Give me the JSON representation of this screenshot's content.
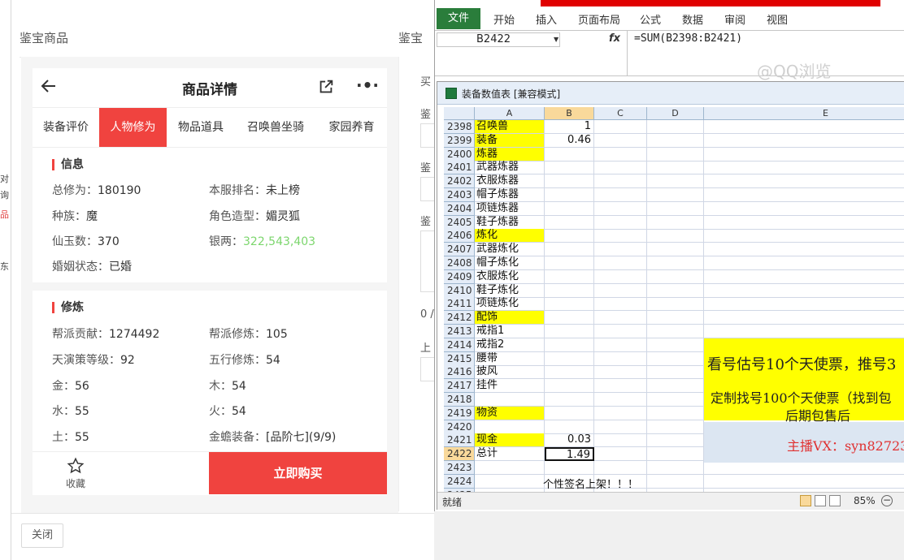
{
  "left_strip": {
    "chars": [
      "对",
      "询",
      "品",
      "东"
    ]
  },
  "dialog": {
    "title": "鉴宝商品",
    "title_right": "鉴宝",
    "close_label": "关闭"
  },
  "phone": {
    "title": "商品详情",
    "tabs": [
      {
        "label": "装备评价",
        "active": false
      },
      {
        "label": "人物修为",
        "active": true
      },
      {
        "label": "物品道具",
        "active": false
      },
      {
        "label": "召唤兽坐骑",
        "active": false
      },
      {
        "label": "家园养育",
        "active": false
      }
    ],
    "info": {
      "title": "信息",
      "rows": [
        {
          "k1": "总修为：",
          "v1": "180190",
          "k2": "本服排名：",
          "v2": "未上榜"
        },
        {
          "k1": "种族：",
          "v1": "魔",
          "k2": "角色造型：",
          "v2": "媚灵狐"
        },
        {
          "k1": "仙玉数：",
          "v1": "370",
          "k2": "银两：",
          "v2": "322,543,403"
        },
        {
          "k1": "婚姻状态：",
          "v1": "已婚",
          "k2": "",
          "v2": ""
        }
      ]
    },
    "cultivation": {
      "title": "修炼",
      "rows": [
        {
          "k1": "帮派贡献：",
          "v1": "1274492",
          "k2": "帮派修炼：",
          "v2": "105"
        },
        {
          "k1": "天演策等级：",
          "v1": "92",
          "k2": "五行修炼：",
          "v2": "54"
        },
        {
          "k1": "金：",
          "v1": "56",
          "k2": "木：",
          "v2": "54"
        },
        {
          "k1": "水：",
          "v1": "55",
          "k2": "火：",
          "v2": "54"
        },
        {
          "k1": "土：",
          "v1": "55",
          "k2": "金蟾装备：",
          "v2": "[品阶七](9/9)"
        }
      ]
    },
    "bottom": {
      "fav_label": "收藏",
      "buy_label": "立即购买"
    },
    "accent": "#f0433f"
  },
  "right_panel": {
    "labels": [
      "买",
      "鉴",
      "鉴",
      "鉴",
      "0 /",
      "上"
    ]
  },
  "excel": {
    "ribbon_tabs": [
      "文件",
      "开始",
      "插入",
      "页面布局",
      "公式",
      "数据",
      "审阅",
      "视图"
    ],
    "name_box": "B2422",
    "fx": "fx",
    "formula": "=SUM(B2398:B2421)",
    "watermark": "@QQ浏览",
    "workbook_name": "装备数值表  [兼容模式]",
    "columns": [
      "A",
      "B",
      "C",
      "D",
      "E"
    ],
    "selected_column": "B",
    "rows": [
      {
        "n": "2398",
        "a": "召唤兽",
        "b": "1",
        "yellow": true
      },
      {
        "n": "2399",
        "a": "装备",
        "b": "0.46",
        "yellow": true
      },
      {
        "n": "2400",
        "a": "炼器",
        "b": "",
        "yellow": true
      },
      {
        "n": "2401",
        "a": "武器炼器",
        "b": "",
        "yellow": false
      },
      {
        "n": "2402",
        "a": "衣服炼器",
        "b": "",
        "yellow": false
      },
      {
        "n": "2403",
        "a": "帽子炼器",
        "b": "",
        "yellow": false
      },
      {
        "n": "2404",
        "a": "项链炼器",
        "b": "",
        "yellow": false
      },
      {
        "n": "2405",
        "a": "鞋子炼器",
        "b": "",
        "yellow": false
      },
      {
        "n": "2406",
        "a": "炼化",
        "b": "",
        "yellow": true
      },
      {
        "n": "2407",
        "a": "武器炼化",
        "b": "",
        "yellow": false
      },
      {
        "n": "2408",
        "a": "帽子炼化",
        "b": "",
        "yellow": false
      },
      {
        "n": "2409",
        "a": "衣服炼化",
        "b": "",
        "yellow": false
      },
      {
        "n": "2410",
        "a": "鞋子炼化",
        "b": "",
        "yellow": false
      },
      {
        "n": "2411",
        "a": "项链炼化",
        "b": "",
        "yellow": false
      },
      {
        "n": "2412",
        "a": "配饰",
        "b": "",
        "yellow": true
      },
      {
        "n": "2413",
        "a": "戒指1",
        "b": "",
        "yellow": false
      },
      {
        "n": "2414",
        "a": "戒指2",
        "b": "",
        "yellow": false
      },
      {
        "n": "2415",
        "a": "腰带",
        "b": "",
        "yellow": false
      },
      {
        "n": "2416",
        "a": "披风",
        "b": "",
        "yellow": false
      },
      {
        "n": "2417",
        "a": "挂件",
        "b": "",
        "yellow": false
      },
      {
        "n": "2418",
        "a": "",
        "b": "",
        "yellow": false
      },
      {
        "n": "2419",
        "a": "物资",
        "b": "",
        "yellow": true
      },
      {
        "n": "2420",
        "a": "",
        "b": "",
        "yellow": false
      },
      {
        "n": "2421",
        "a": "现金",
        "b": "0.03",
        "yellow": true
      },
      {
        "n": "2422",
        "a": "总计",
        "b": "1.49",
        "yellow": false
      },
      {
        "n": "2423",
        "a": "",
        "b": "",
        "yellow": false
      },
      {
        "n": "2424",
        "a": "",
        "b": "",
        "yellow": false
      },
      {
        "n": "2425",
        "a": "",
        "b": "",
        "yellow": false
      }
    ],
    "selected_row": "2422",
    "row_2424_text": "个性签名上架！！！",
    "banner_yellow": {
      "line1": "看号估号10个天使票，推号3",
      "line2": "定制找号100个天使票（找到包",
      "line3": "后期包售后"
    },
    "banner_contact": {
      "line1": "主播VX：syn82723"
    },
    "status": {
      "ready": "就绪",
      "zoom": "85%"
    }
  }
}
